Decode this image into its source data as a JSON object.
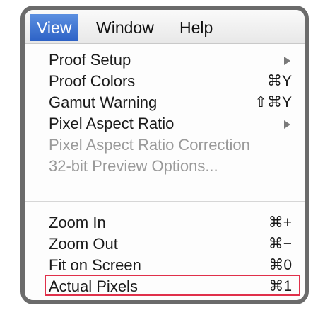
{
  "menubar": {
    "items": [
      {
        "label": "View"
      },
      {
        "label": "Window"
      },
      {
        "label": "Help"
      }
    ]
  },
  "menu": {
    "items": [
      {
        "label": "Proof Setup",
        "shortcut": "",
        "submenu": true,
        "enabled": true
      },
      {
        "label": "Proof Colors",
        "shortcut": "⌘Y",
        "submenu": false,
        "enabled": true
      },
      {
        "label": "Gamut Warning",
        "shortcut": "⇧⌘Y",
        "submenu": false,
        "enabled": true
      },
      {
        "label": "Pixel Aspect Ratio",
        "shortcut": "",
        "submenu": true,
        "enabled": true
      },
      {
        "label": "Pixel Aspect Ratio Correction",
        "shortcut": "",
        "submenu": false,
        "enabled": false
      },
      {
        "label": "32-bit Preview Options...",
        "shortcut": "",
        "submenu": false,
        "enabled": false
      },
      {
        "label": "Zoom In",
        "shortcut": "⌘+",
        "submenu": false,
        "enabled": true
      },
      {
        "label": "Zoom Out",
        "shortcut": "⌘−",
        "submenu": false,
        "enabled": true
      },
      {
        "label": "Fit on Screen",
        "shortcut": "⌘0",
        "submenu": false,
        "enabled": true
      },
      {
        "label": "Actual Pixels",
        "shortcut": "⌘1",
        "submenu": false,
        "enabled": true,
        "highlighted": true
      }
    ]
  },
  "colors": {
    "active_menu": "#2d62c6",
    "highlight_outline": "#e0304a",
    "disabled_text": "#9a9a9a"
  }
}
